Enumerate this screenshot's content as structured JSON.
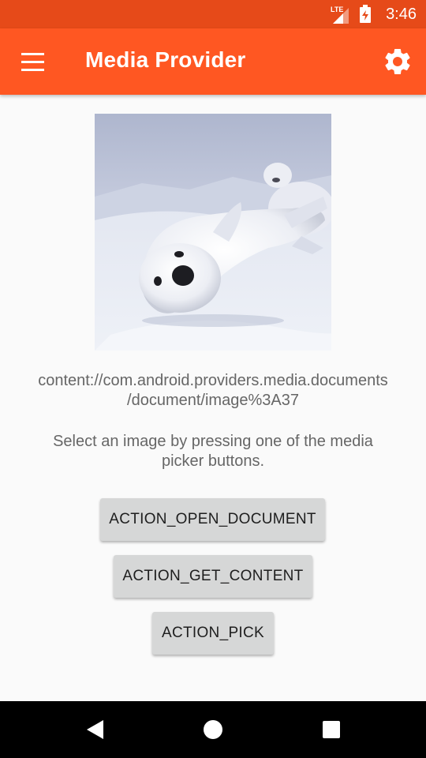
{
  "status_bar": {
    "time": "3:46",
    "network_label": "LTE",
    "icons": [
      "lte-signal-icon",
      "battery-charging-icon"
    ],
    "color": "#e64a19"
  },
  "app_bar": {
    "title": "Media Provider",
    "color": "#ff5722",
    "icons": [
      "menu-icon",
      "gear-icon"
    ]
  },
  "main": {
    "image_alt": "Baby harp seals lying on snow",
    "uri": "content://com.android.providers.media.documents\n/document/image%3A37",
    "hint": "Select an image by pressing one of the media picker buttons.",
    "buttons": [
      {
        "label": "ACTION_OPEN_DOCUMENT"
      },
      {
        "label": "ACTION_GET_CONTENT"
      },
      {
        "label": "ACTION_PICK"
      }
    ]
  },
  "nav_bar": {
    "icons": [
      "back-icon",
      "home-icon",
      "recents-icon"
    ]
  }
}
